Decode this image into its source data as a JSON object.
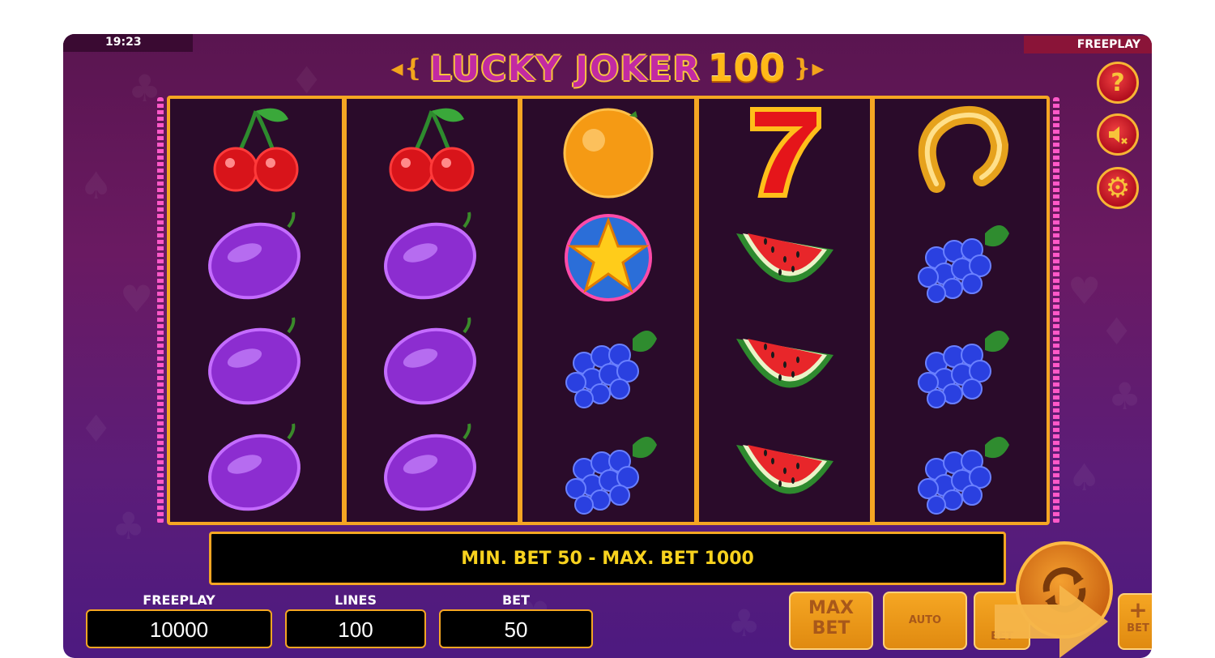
{
  "status_bar": {
    "time": "19:23",
    "mode": "FREEPLAY"
  },
  "logo": {
    "title": "LUCKY JOKER",
    "number": "100"
  },
  "side_buttons": {
    "help": "?"
  },
  "reels": [
    [
      "cherries",
      "plum",
      "plum",
      "plum"
    ],
    [
      "cherries",
      "plum",
      "plum",
      "plum"
    ],
    [
      "orange",
      "star",
      "grapes",
      "grapes"
    ],
    [
      "seven",
      "watermelon",
      "watermelon",
      "watermelon"
    ],
    [
      "horseshoe",
      "grapes",
      "grapes",
      "grapes"
    ]
  ],
  "info_bar": {
    "message": "MIN. BET 50 - MAX. BET 1000"
  },
  "stats": {
    "freeplay": {
      "label": "FREEPLAY",
      "value": "10000"
    },
    "lines": {
      "label": "LINES",
      "value": "100"
    },
    "bet": {
      "label": "BET",
      "value": "50"
    }
  },
  "controls": {
    "max_bet_line1": "MAX",
    "max_bet_line2": "BET",
    "auto": "AUTO",
    "bet_minus": "BET",
    "bet_plus": "BET",
    "plus_symbol": "+"
  },
  "colors": {
    "accent": "#f5a623",
    "reel_bg": "#2a0b2a",
    "info_text": "#f8d21e",
    "pointer_arrow": "#f5b54a"
  }
}
